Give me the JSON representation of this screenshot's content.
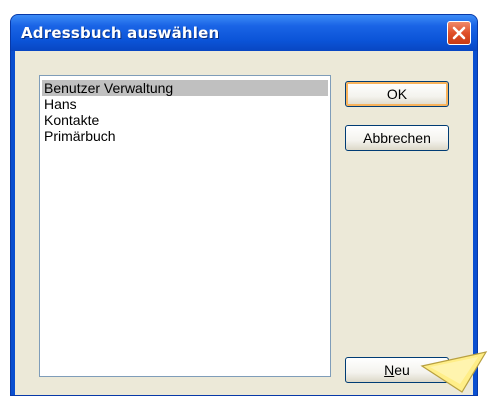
{
  "dialog": {
    "title": "Adressbuch auswählen",
    "close_icon": "close-icon"
  },
  "list": {
    "items": [
      {
        "label": "Benutzer Verwaltung",
        "selected": true
      },
      {
        "label": "Hans",
        "selected": false
      },
      {
        "label": "Kontakte",
        "selected": false
      },
      {
        "label": "Primärbuch",
        "selected": false
      }
    ]
  },
  "buttons": {
    "ok_label": "OK",
    "cancel_label": "Abbrechen",
    "new_mnemonic": "N",
    "new_rest": "eu"
  },
  "colors": {
    "titlebar": "#0b54d8",
    "client": "#ece9d8",
    "selection": "#c0c0c0",
    "pointer": "#ffee88"
  },
  "overlay": {
    "pointer_icon": "callout-pointer-icon"
  }
}
